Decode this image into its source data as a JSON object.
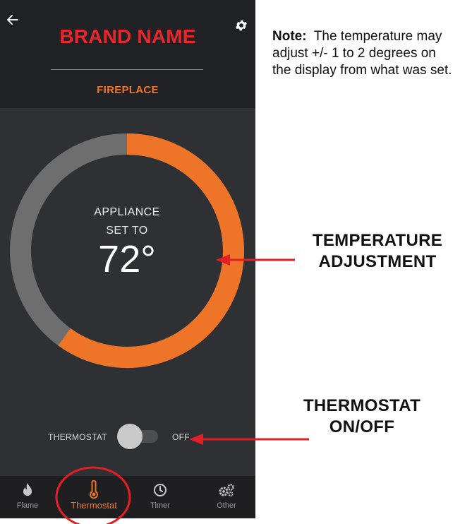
{
  "app": {
    "brand_name": "BRAND NAME",
    "subtitle": "FIREPLACE",
    "brand_color": "#e8262c",
    "accent_color": "#ee7528"
  },
  "header": {
    "back_icon": "arrow-left",
    "settings_icon": "gear"
  },
  "dial": {
    "label_line1": "APPLIANCE",
    "label_line2": "SET TO",
    "temperature": "72°",
    "setpoint_value": 72,
    "fill_fraction": 0.6,
    "fill_color": "#ee7528",
    "track_color": "#6e6e6e"
  },
  "thermostat_toggle": {
    "label": "THERMOSTAT",
    "state": "OFF",
    "on": false
  },
  "nav": {
    "items": [
      {
        "label": "Flame",
        "icon": "flame"
      },
      {
        "label": "Thermostat",
        "icon": "thermometer",
        "active": true
      },
      {
        "label": "Timer",
        "icon": "clock"
      },
      {
        "label": "Other",
        "icon": "gears"
      }
    ]
  },
  "annotations": {
    "note_label": "Note:",
    "note_text": "The temperature may adjust +/- 1 to 2 degrees on the display from what was set.",
    "callout_temp_line1": "TEMPERATURE",
    "callout_temp_line2": "ADJUSTMENT",
    "callout_toggle_line1": "THERMOSTAT",
    "callout_toggle_line2": "ON/OFF",
    "arrow_color": "#e31e24"
  }
}
